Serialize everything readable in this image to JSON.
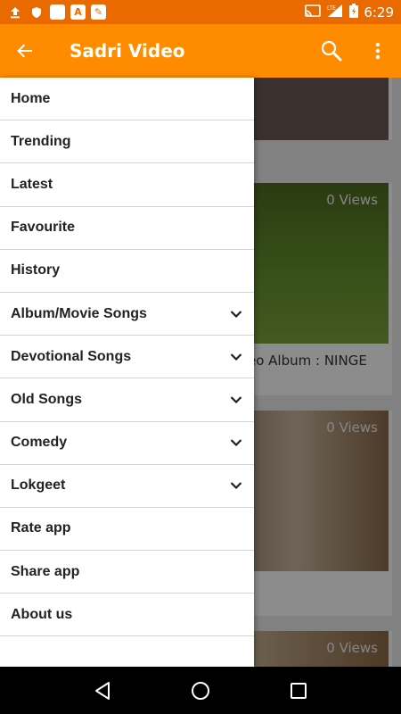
{
  "status_bar": {
    "time": "6:29",
    "network": "LTE",
    "battery_icon": "battery-charging-icon"
  },
  "app_bar": {
    "title": "Sadri Video",
    "back_icon": "arrow-back-icon",
    "search_icon": "search-icon",
    "more_icon": "more-vert-icon"
  },
  "colors": {
    "status_bar": "#e86a00",
    "app_bar": "#ff8c00"
  },
  "drawer": {
    "items": [
      {
        "label": "Home"
      },
      {
        "label": "Trending"
      },
      {
        "label": "Latest"
      },
      {
        "label": "Favourite"
      },
      {
        "label": "History"
      },
      {
        "label": "Album/Movie Songs",
        "expandable": true
      },
      {
        "label": "Devotional Songs",
        "expandable": true
      },
      {
        "label": "Old Songs",
        "expandable": true
      },
      {
        "label": "Comedy",
        "expandable": true
      },
      {
        "label": "Lokgeet",
        "expandable": true
      },
      {
        "label": "Rate app"
      },
      {
        "label": "Share app"
      },
      {
        "label": "About us"
      }
    ]
  },
  "videos": [
    {
      "views": "0 Views",
      "title": "eo Album :  NINGE"
    },
    {
      "views": "0 Views"
    },
    {
      "views": "0 Views"
    }
  ]
}
